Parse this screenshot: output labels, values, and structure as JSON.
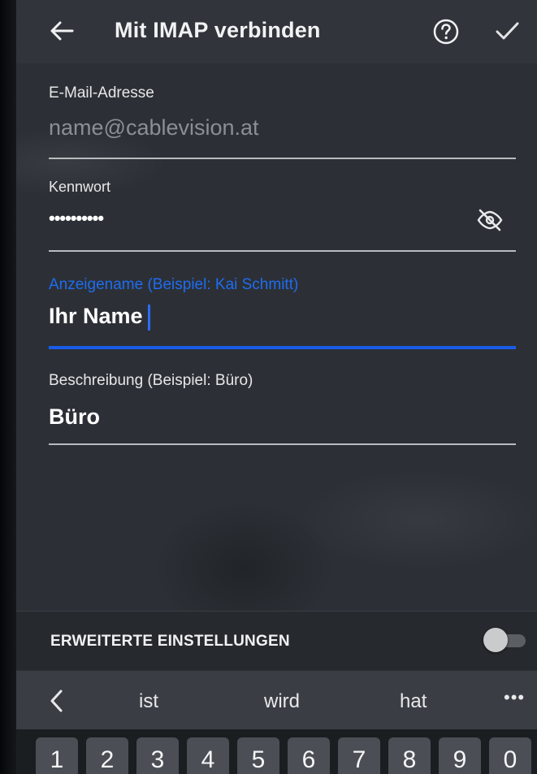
{
  "appbar": {
    "title": "Mit IMAP verbinden",
    "back_icon": "arrow-left-icon",
    "help_icon": "help-circle-icon",
    "confirm_icon": "checkmark-icon"
  },
  "form": {
    "email": {
      "label": "E-Mail-Adresse",
      "placeholder": "name@cablevision.at",
      "value": ""
    },
    "password": {
      "label": "Kennwort",
      "value": "••••••••••",
      "visibility_icon": "eye-off-icon"
    },
    "display_name": {
      "label": "Anzeigename (Beispiel: Kai Schmitt)",
      "value": "Ihr Name",
      "focused": true
    },
    "description": {
      "label": "Beschreibung (Beispiel: Büro)",
      "value": "Büro"
    }
  },
  "advanced_settings": {
    "label": "ERWEITERTE EINSTELLUNGEN",
    "enabled": false
  },
  "keyboard": {
    "suggestions": [
      "ist",
      "wird",
      "hat"
    ],
    "more_label": "•••",
    "number_keys": [
      "1",
      "2",
      "3",
      "4",
      "5",
      "6",
      "7",
      "8",
      "9",
      "0"
    ]
  },
  "colors": {
    "accent": "#1a5ce8",
    "background": "#2c3036",
    "text": "#ffffff"
  }
}
